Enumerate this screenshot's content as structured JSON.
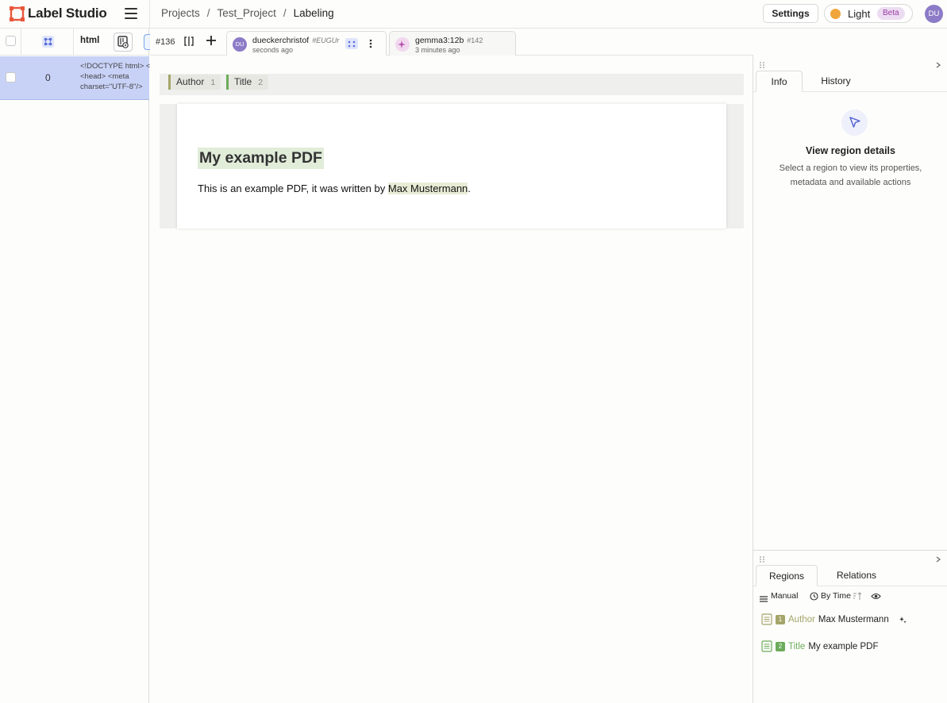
{
  "app": {
    "name": "Label Studio"
  },
  "breadcrumb": {
    "items": [
      "Projects",
      "Test_Project",
      "Labeling"
    ],
    "separator": "/"
  },
  "header": {
    "settings_label": "Settings",
    "theme_label": "Light",
    "beta_label": "Beta",
    "user_initials": "DU"
  },
  "datamanager": {
    "column_header": "html",
    "rows": [
      {
        "index": "0",
        "html_lines": [
          "<!DOCTYPE html> <",
          "<head> <meta",
          "charset=\"UTF-8\"/>"
        ]
      }
    ]
  },
  "task": {
    "id": "#136"
  },
  "annotations": [
    {
      "author": "dueckerchristof",
      "hash": "#EUGUr",
      "time": "seconds ago",
      "initials": "DU"
    },
    {
      "author": "gemma3:12b",
      "hash": "#142",
      "time": "3 minutes ago"
    }
  ],
  "labels": [
    {
      "name": "Author",
      "hotkey": "1",
      "color": "#a4a56a"
    },
    {
      "name": "Title",
      "hotkey": "2",
      "color": "#6cab5a"
    }
  ],
  "document": {
    "title": "My example PDF",
    "body_prefix": "This is an example PDF, it was written by ",
    "body_highlight": "Max Mustermann",
    "body_suffix": "."
  },
  "right_panel": {
    "tabs": [
      "Info",
      "History"
    ],
    "info_title": "View region details",
    "info_desc": "Select a region to view its properties, metadata and available actions",
    "bottom_tabs": [
      "Regions",
      "Relations"
    ],
    "toolbar": {
      "group_label": "Manual",
      "sort_label": "By Time"
    },
    "regions": [
      {
        "index": "1",
        "label": "Author",
        "text": "Max Mustermann",
        "color": "#a4a56a"
      },
      {
        "index": "2",
        "label": "Title",
        "text": "My example PDF",
        "color": "#6cab5a"
      }
    ]
  }
}
